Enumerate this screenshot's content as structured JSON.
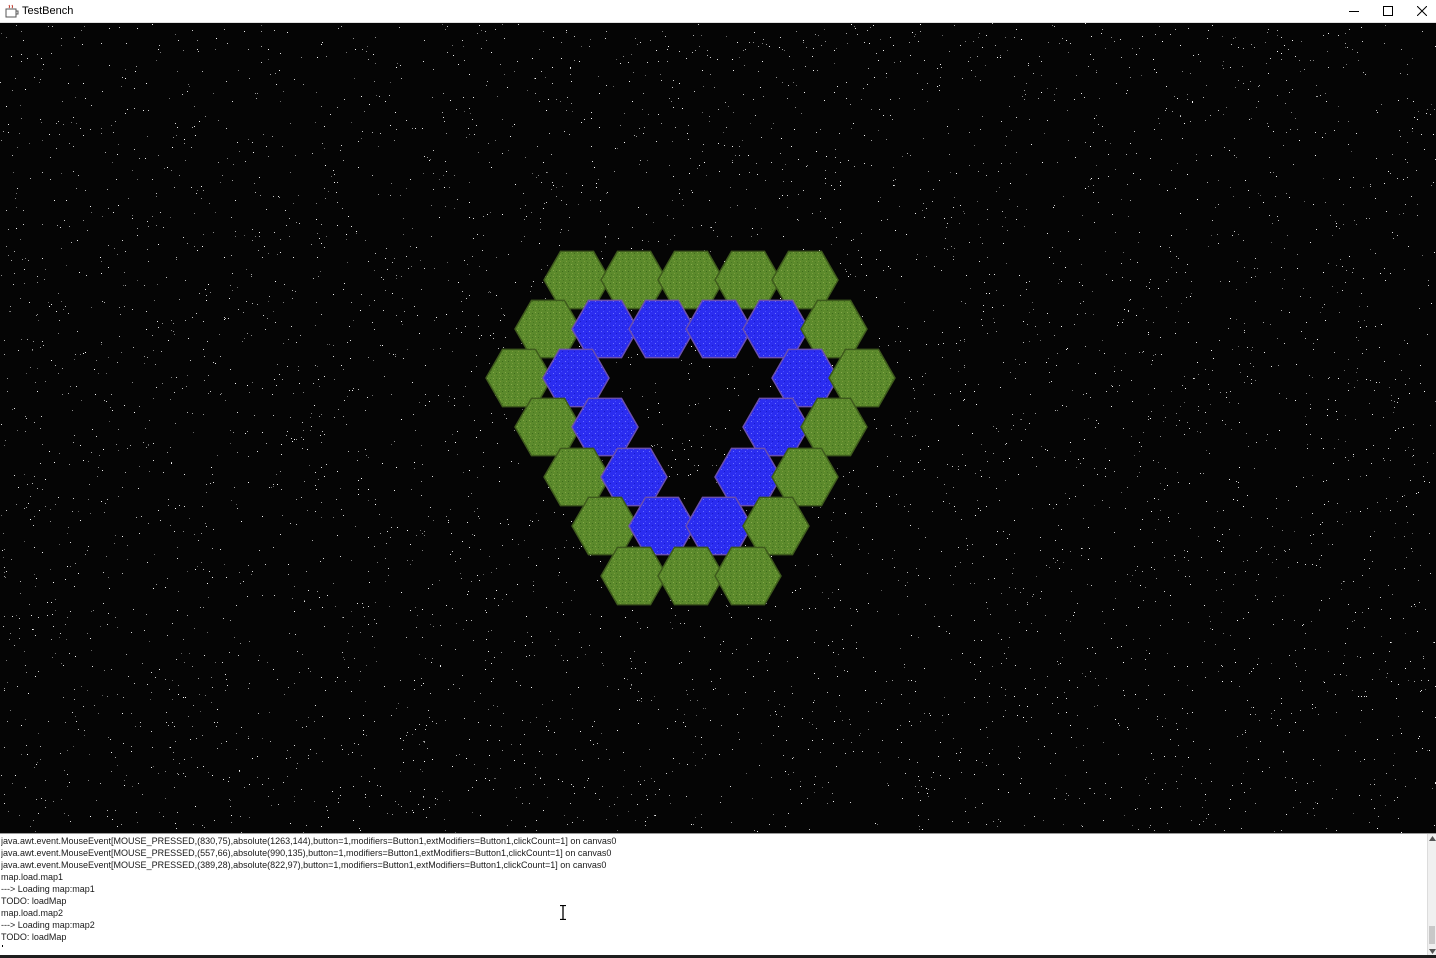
{
  "window": {
    "title": "TestBench",
    "app_icon": "java-cup-icon",
    "controls": [
      "minimize-icon",
      "maximize-icon",
      "close-icon"
    ]
  },
  "canvas": {
    "name": "canvas0",
    "background_color": "#050505",
    "tile_colors": {
      "grass": "#5f8a2e",
      "grass_edge": "#3e5b1c",
      "water": "#2a2af0",
      "water_edge": "#6a4fb0"
    }
  },
  "console": {
    "lines": [
      "java.awt.event.MouseEvent[MOUSE_PRESSED,(830,75),absolute(1263,144),button=1,modifiers=Button1,extModifiers=Button1,clickCount=1] on canvas0",
      "java.awt.event.MouseEvent[MOUSE_PRESSED,(557,66),absolute(990,135),button=1,modifiers=Button1,extModifiers=Button1,clickCount=1] on canvas0",
      "java.awt.event.MouseEvent[MOUSE_PRESSED,(389,28),absolute(822,97),button=1,modifiers=Button1,extModifiers=Button1,clickCount=1] on canvas0",
      "map.load.map1",
      "---> Loading map:map1",
      "TODO: loadMap",
      "map.load.map2",
      "---> Loading map:map2",
      "TODO: loadMap"
    ]
  }
}
